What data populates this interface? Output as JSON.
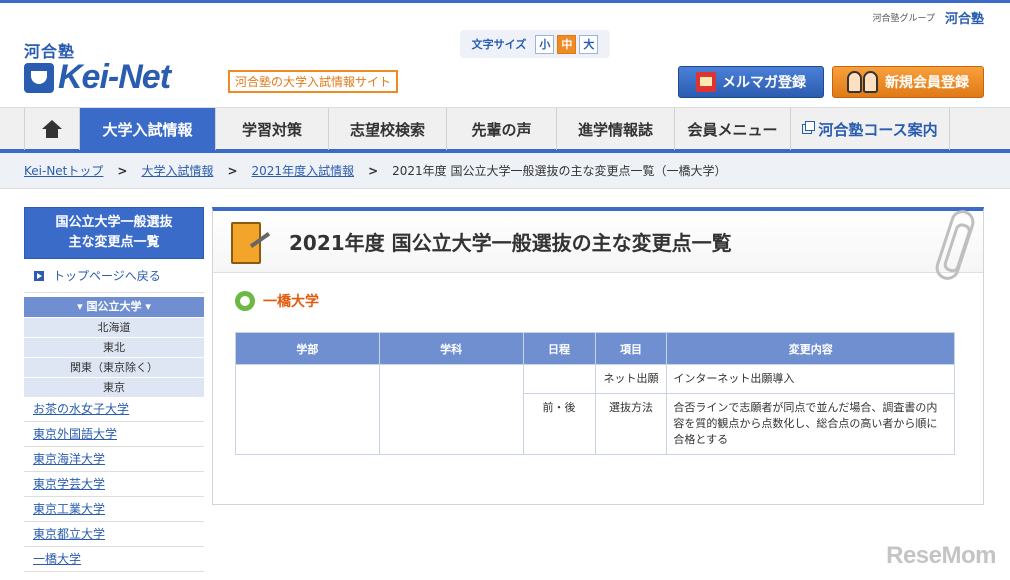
{
  "header": {
    "group_label": "河合塾グループ",
    "group_logo": "河合塾",
    "logo_kana": "河合塾",
    "logo_text": "Kei-Net",
    "tagline": "河合塾の大学入試情報サイト",
    "font_size": {
      "label": "文字サイズ",
      "options": [
        "小",
        "中",
        "大"
      ],
      "selected": "中"
    },
    "mail_button": "メルマガ登録",
    "register_button": "新規会員登録"
  },
  "nav": {
    "items": [
      "大学入試情報",
      "学習対策",
      "志望校検索",
      "先輩の声",
      "進学情報誌",
      "会員メニュー",
      "河合塾コース案内"
    ],
    "active": "大学入試情報"
  },
  "breadcrumb": {
    "links": [
      "Kei-Netトップ",
      "大学入試情報",
      "2021年度入試情報"
    ],
    "current": "2021年度 国公立大学一般選抜の主な変更点一覧（一橋大学）"
  },
  "sidebar": {
    "title_line1": "国公立大学一般選抜",
    "title_line2": "主な変更点一覧",
    "back_link": "トップページへ戻る",
    "national_label": "▾ 国公立大学 ▾",
    "regions": [
      "北海道",
      "東北",
      "関東（東京除く）",
      "東京"
    ],
    "universities": [
      "お茶の水女子大学",
      "東京外国語大学",
      "東京海洋大学",
      "東京学芸大学",
      "東京工業大学",
      "東京都立大学",
      "一橋大学"
    ]
  },
  "main": {
    "title": "2021年度 国公立大学一般選抜の主な変更点一覧",
    "university": "一橋大学",
    "table": {
      "headers": [
        "学部",
        "学科",
        "日程",
        "項目",
        "変更内容"
      ],
      "rows": [
        {
          "schedule": "",
          "item": "ネット出願",
          "change": "インターネット出願導入"
        },
        {
          "schedule": "前・後",
          "item": "選抜方法",
          "change": "合否ラインで志願者が同点で並んだ場合、調査書の内容を質的観点から点数化し、総合点の高い者から順に合格とする"
        }
      ]
    }
  },
  "watermark": "ReseMom"
}
